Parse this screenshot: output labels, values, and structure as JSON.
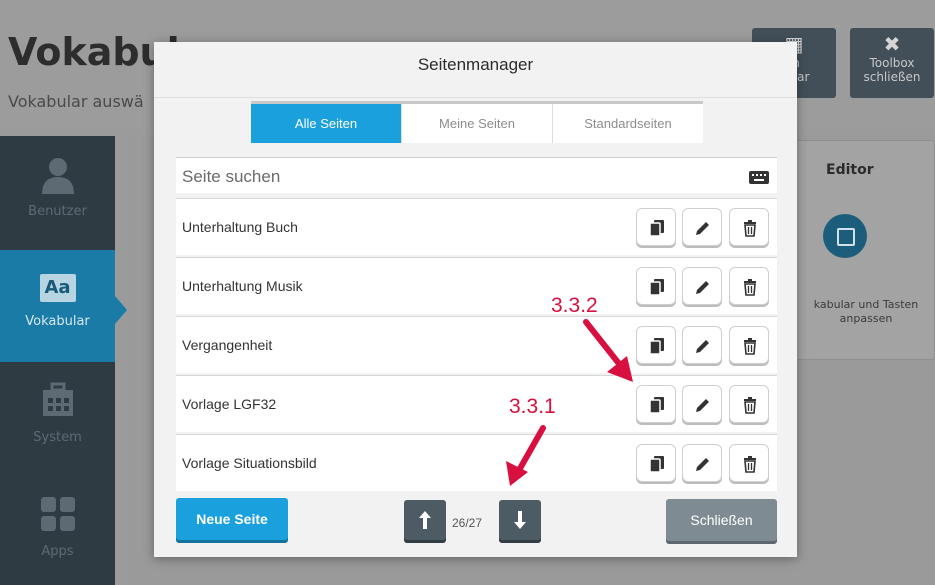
{
  "background": {
    "title": "Vokabul",
    "subtitle": "Vokabular auswä",
    "header_buttons": [
      {
        "icon": "grid-icon",
        "label": "m\nbular"
      },
      {
        "icon": "close-icon",
        "label": "Toolbox\nschließen"
      }
    ],
    "sidebar": {
      "items": [
        {
          "label": "Benutzer",
          "icon": "user-icon"
        },
        {
          "label": "Vokabular",
          "icon": "aa-icon",
          "active": true,
          "icon_text": "Aa"
        },
        {
          "label": "System",
          "icon": "toolbox-icon"
        },
        {
          "label": "Apps",
          "icon": "apps-grid-icon"
        }
      ]
    },
    "editor_card": {
      "title": "Editor",
      "text": "kabular und Tasten anpassen"
    }
  },
  "modal": {
    "title": "Seitenmanager",
    "tabs": [
      {
        "label": "Alle Seiten",
        "active": true
      },
      {
        "label": "Meine Seiten",
        "active": false
      },
      {
        "label": "Standardseiten",
        "active": false
      }
    ],
    "search": {
      "placeholder": "Seite suchen",
      "value": ""
    },
    "rows": [
      {
        "label": "Unterhaltung Buch"
      },
      {
        "label": "Unterhaltung Musik"
      },
      {
        "label": "Vergangenheit"
      },
      {
        "label": "Vorlage LGF32"
      },
      {
        "label": "Vorlage Situationsbild"
      }
    ],
    "footer": {
      "new_page_label": "Neue Seite",
      "page_counter": "26/27",
      "close_label": "Schließen"
    }
  },
  "annotations": {
    "label_1": "3.3.2",
    "label_2": "3.3.1",
    "color": "#d8103f"
  },
  "colors": {
    "accent": "#1aa0dc",
    "dark_button": "#4d5b64",
    "close_button": "#7f8b92"
  }
}
